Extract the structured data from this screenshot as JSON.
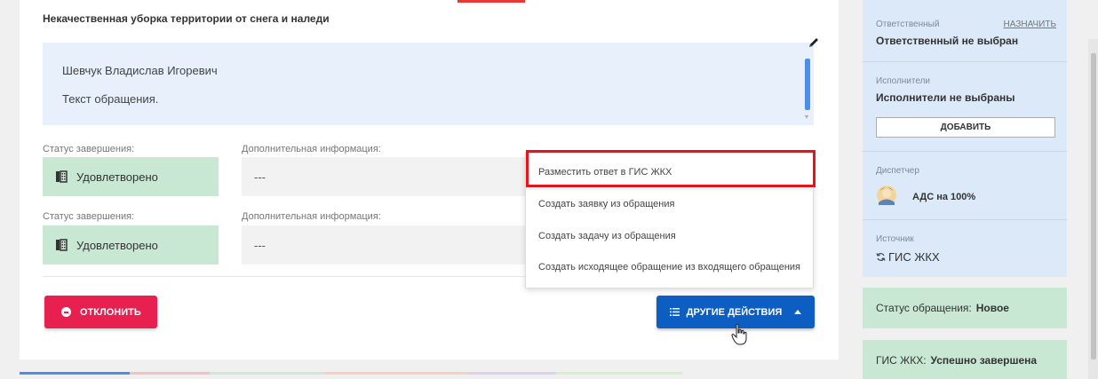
{
  "appeal": {
    "title": "Некачественная уборка территории от снега и наледи",
    "author": "Шевчук Владислав Игоревич",
    "text": "Текст обращения."
  },
  "completion_rows": [
    {
      "status_label": "Статус завершения:",
      "status_value": "Удовлетворено",
      "info_label": "Дополнительная информация:",
      "info_value": "---"
    },
    {
      "status_label": "Статус завершения:",
      "status_value": "Удовлетворено",
      "info_label": "Дополнительная информация:",
      "info_value": "---"
    }
  ],
  "actions": {
    "reject_label": "ОТКЛОНИТЬ",
    "other_label": "ДРУГИЕ ДЕЙСТВИЯ"
  },
  "dropdown": {
    "items": [
      "Разместить ответ в ГИС ЖКХ",
      "Создать заявку из обращения",
      "Создать задачу из обращения",
      "Создать исходящее обращение из входящего обращения"
    ]
  },
  "sidebar": {
    "responsible_label": "Ответственный",
    "assign_link": "НАЗНАЧИТЬ",
    "responsible_value": "Ответственный не выбран",
    "executors_label": "Исполнители",
    "executors_value": "Исполнители не выбраны",
    "add_button": "ДОБАВИТЬ",
    "dispatcher_label": "Диспетчер",
    "dispatcher_value": "АДС на 100%",
    "source_label": "Источник",
    "source_value": "ГИС ЖКХ"
  },
  "status_cards": {
    "appeal_status_label": "Статус обращения:",
    "appeal_status_value": "Новое",
    "gis_label": "ГИС ЖКХ:",
    "gis_value": "Успешно завершена"
  },
  "colors": {
    "reject": "#e8204f",
    "primary": "#0d5ec3",
    "highlight": "#e8141c",
    "success_bg": "#c8e8d4",
    "info_bg": "#dbe9f8"
  },
  "icons": [
    "pencil-icon",
    "phone-book-icon",
    "minus-circle-icon",
    "list-icon",
    "caret-up-icon",
    "hand-cursor-icon",
    "avatar-icon",
    "sync-icon"
  ]
}
